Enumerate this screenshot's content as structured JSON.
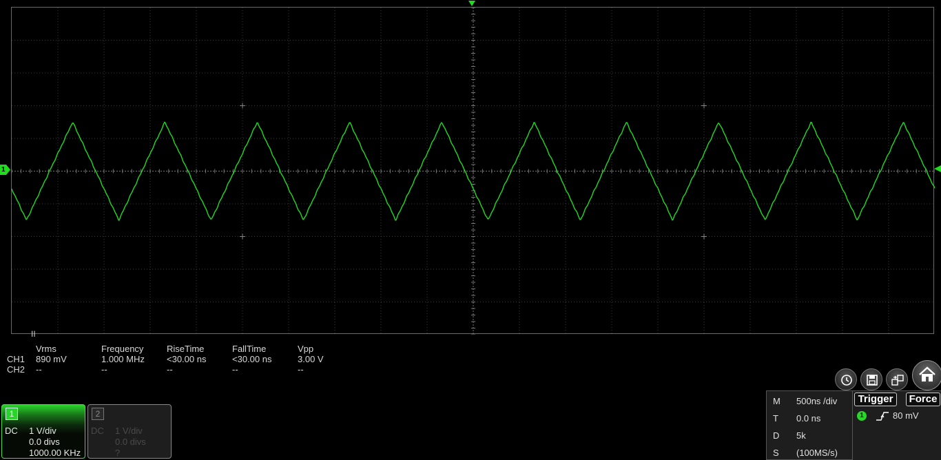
{
  "screen": {
    "run_state": "II",
    "ch1_marker": "1",
    "waveform": {
      "shape": "triangle",
      "color": "#1fdc1f",
      "cycles": 10,
      "peak_divs": 1.5,
      "trough_divs": -1.5
    }
  },
  "measurements": {
    "headers": [
      "Vrms",
      "Frequency",
      "RiseTime",
      "FallTime",
      "Vpp"
    ],
    "rows": [
      {
        "label": "CH1",
        "values": [
          "890 mV",
          "1.000 MHz",
          "<30.00 ns",
          "<30.00 ns",
          "3.00 V"
        ]
      },
      {
        "label": "CH2",
        "values": [
          "--",
          "--",
          "--",
          "--",
          "--"
        ]
      }
    ]
  },
  "channels": [
    {
      "num": "1",
      "coupling": "DC",
      "vdiv": "1 V/div",
      "offset": "0.0 divs",
      "freq": "1000.00 KHz",
      "active": true,
      "color": "#2ad42a"
    },
    {
      "num": "2",
      "coupling": "DC",
      "vdiv": "1 V/div",
      "offset": "0.0 divs",
      "freq": "?",
      "active": false
    }
  ],
  "toolbar": {
    "icons": [
      "auto-setup-icon",
      "save-icon",
      "display-switch-icon",
      "home-icon"
    ]
  },
  "timebase": {
    "M_key": "M",
    "M_val": "500ns /div",
    "T_key": "T",
    "T_val": "0.0 ns",
    "D_key": "D",
    "D_val": "5k",
    "S_key": "S",
    "S_val": "(100MS/s)"
  },
  "trigger": {
    "trigger_label": "Trigger",
    "force_label": "Force",
    "source": "1",
    "edge": "rising",
    "level": "80 mV"
  }
}
